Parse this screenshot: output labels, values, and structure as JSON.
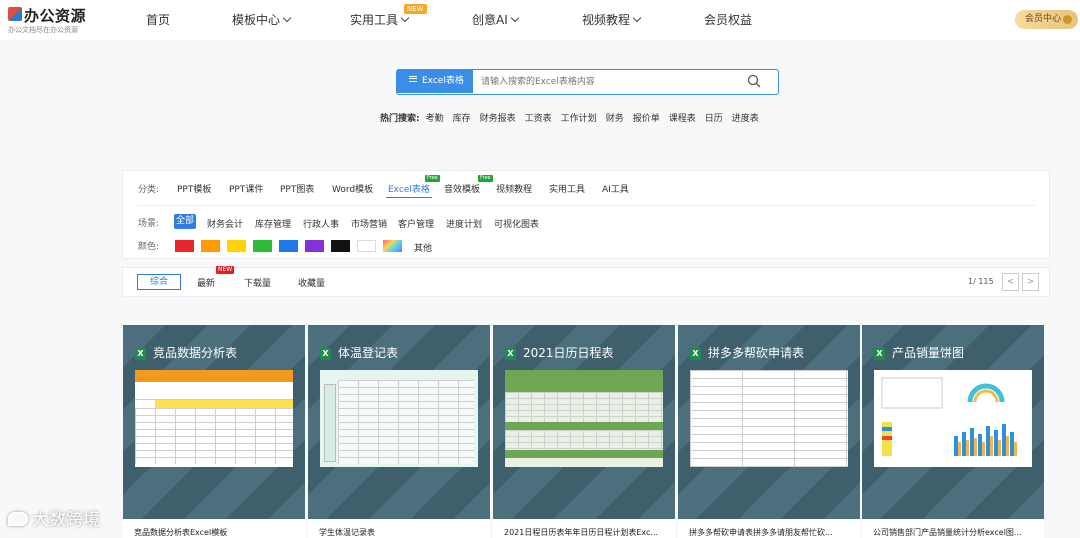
{
  "header": {
    "logo_title": "办公资源",
    "logo_subtitle": "办公文档尽在办公资源",
    "nav": [
      {
        "label": "首页"
      },
      {
        "label": "模板中心"
      },
      {
        "label": "实用工具"
      },
      {
        "label": "创意AI"
      },
      {
        "label": "视频教程"
      },
      {
        "label": "会员权益"
      }
    ],
    "new_badge": "NEW",
    "member_button": "会员中心"
  },
  "search": {
    "category": "Excel表格",
    "placeholder": "请输入搜索的Excel表格内容",
    "hot_label": "热门搜索:",
    "hot_items": [
      "考勤",
      "库存",
      "财务报表",
      "工资表",
      "工作计划",
      "财务",
      "报价单",
      "课程表",
      "日历",
      "进度表"
    ]
  },
  "filter": {
    "category_label": "分类:",
    "categories": [
      "PPT模板",
      "PPT课件",
      "PPT图表",
      "Word模板",
      "Excel表格",
      "音效模板",
      "视频教程",
      "实用工具",
      "AI工具"
    ],
    "free_badge": "Free",
    "scene_label": "场景:",
    "scenes": [
      "全部",
      "财务会计",
      "库存管理",
      "行政人事",
      "市场营销",
      "客户管理",
      "进度计划",
      "可视化图表"
    ],
    "color_label": "颜色:",
    "colors": [
      "#e8262b",
      "#ff9b00",
      "#ffd400",
      "#2fba3a",
      "#1e78e6",
      "#8232d8",
      "#111111",
      "#ffffff"
    ],
    "other_color": "其他"
  },
  "sort": {
    "options": [
      "综合",
      "最新",
      "下载量",
      "收藏量"
    ],
    "new_badge": "NEW",
    "page_info": "1/ 115",
    "prev": "<",
    "next": ">"
  },
  "cards": [
    {
      "header": "竞品数据分析表",
      "title": "竞品数据分析表Excel模板"
    },
    {
      "header": "体温登记表",
      "title": "学生体温记录表"
    },
    {
      "header": "2021日历日程表",
      "title": "2021日程日历表年年日历日程计划表Exc..."
    },
    {
      "header": "拼多多帮砍申请表",
      "title": "拼多多帮砍申请表拼多多请朋友帮忙砍..."
    },
    {
      "header": "产品销量饼图",
      "title": "公司销售部门产品销量统计分析excel图..."
    }
  ],
  "watermark": "大数跨境"
}
